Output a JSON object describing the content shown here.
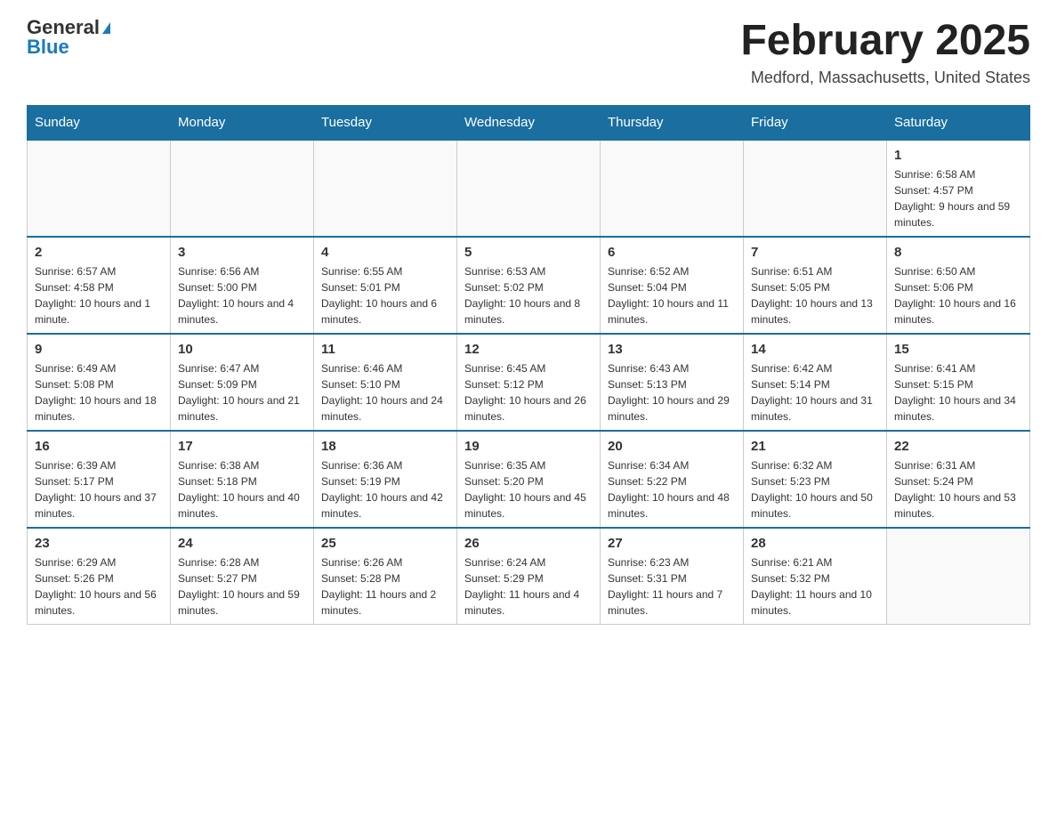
{
  "header": {
    "logo": {
      "general": "General",
      "blue": "Blue",
      "triangle": "▶"
    },
    "title": "February 2025",
    "location": "Medford, Massachusetts, United States"
  },
  "weekdays": [
    "Sunday",
    "Monday",
    "Tuesday",
    "Wednesday",
    "Thursday",
    "Friday",
    "Saturday"
  ],
  "weeks": [
    [
      {
        "day": "",
        "info": ""
      },
      {
        "day": "",
        "info": ""
      },
      {
        "day": "",
        "info": ""
      },
      {
        "day": "",
        "info": ""
      },
      {
        "day": "",
        "info": ""
      },
      {
        "day": "",
        "info": ""
      },
      {
        "day": "1",
        "info": "Sunrise: 6:58 AM\nSunset: 4:57 PM\nDaylight: 9 hours and 59 minutes."
      }
    ],
    [
      {
        "day": "2",
        "info": "Sunrise: 6:57 AM\nSunset: 4:58 PM\nDaylight: 10 hours and 1 minute."
      },
      {
        "day": "3",
        "info": "Sunrise: 6:56 AM\nSunset: 5:00 PM\nDaylight: 10 hours and 4 minutes."
      },
      {
        "day": "4",
        "info": "Sunrise: 6:55 AM\nSunset: 5:01 PM\nDaylight: 10 hours and 6 minutes."
      },
      {
        "day": "5",
        "info": "Sunrise: 6:53 AM\nSunset: 5:02 PM\nDaylight: 10 hours and 8 minutes."
      },
      {
        "day": "6",
        "info": "Sunrise: 6:52 AM\nSunset: 5:04 PM\nDaylight: 10 hours and 11 minutes."
      },
      {
        "day": "7",
        "info": "Sunrise: 6:51 AM\nSunset: 5:05 PM\nDaylight: 10 hours and 13 minutes."
      },
      {
        "day": "8",
        "info": "Sunrise: 6:50 AM\nSunset: 5:06 PM\nDaylight: 10 hours and 16 minutes."
      }
    ],
    [
      {
        "day": "9",
        "info": "Sunrise: 6:49 AM\nSunset: 5:08 PM\nDaylight: 10 hours and 18 minutes."
      },
      {
        "day": "10",
        "info": "Sunrise: 6:47 AM\nSunset: 5:09 PM\nDaylight: 10 hours and 21 minutes."
      },
      {
        "day": "11",
        "info": "Sunrise: 6:46 AM\nSunset: 5:10 PM\nDaylight: 10 hours and 24 minutes."
      },
      {
        "day": "12",
        "info": "Sunrise: 6:45 AM\nSunset: 5:12 PM\nDaylight: 10 hours and 26 minutes."
      },
      {
        "day": "13",
        "info": "Sunrise: 6:43 AM\nSunset: 5:13 PM\nDaylight: 10 hours and 29 minutes."
      },
      {
        "day": "14",
        "info": "Sunrise: 6:42 AM\nSunset: 5:14 PM\nDaylight: 10 hours and 31 minutes."
      },
      {
        "day": "15",
        "info": "Sunrise: 6:41 AM\nSunset: 5:15 PM\nDaylight: 10 hours and 34 minutes."
      }
    ],
    [
      {
        "day": "16",
        "info": "Sunrise: 6:39 AM\nSunset: 5:17 PM\nDaylight: 10 hours and 37 minutes."
      },
      {
        "day": "17",
        "info": "Sunrise: 6:38 AM\nSunset: 5:18 PM\nDaylight: 10 hours and 40 minutes."
      },
      {
        "day": "18",
        "info": "Sunrise: 6:36 AM\nSunset: 5:19 PM\nDaylight: 10 hours and 42 minutes."
      },
      {
        "day": "19",
        "info": "Sunrise: 6:35 AM\nSunset: 5:20 PM\nDaylight: 10 hours and 45 minutes."
      },
      {
        "day": "20",
        "info": "Sunrise: 6:34 AM\nSunset: 5:22 PM\nDaylight: 10 hours and 48 minutes."
      },
      {
        "day": "21",
        "info": "Sunrise: 6:32 AM\nSunset: 5:23 PM\nDaylight: 10 hours and 50 minutes."
      },
      {
        "day": "22",
        "info": "Sunrise: 6:31 AM\nSunset: 5:24 PM\nDaylight: 10 hours and 53 minutes."
      }
    ],
    [
      {
        "day": "23",
        "info": "Sunrise: 6:29 AM\nSunset: 5:26 PM\nDaylight: 10 hours and 56 minutes."
      },
      {
        "day": "24",
        "info": "Sunrise: 6:28 AM\nSunset: 5:27 PM\nDaylight: 10 hours and 59 minutes."
      },
      {
        "day": "25",
        "info": "Sunrise: 6:26 AM\nSunset: 5:28 PM\nDaylight: 11 hours and 2 minutes."
      },
      {
        "day": "26",
        "info": "Sunrise: 6:24 AM\nSunset: 5:29 PM\nDaylight: 11 hours and 4 minutes."
      },
      {
        "day": "27",
        "info": "Sunrise: 6:23 AM\nSunset: 5:31 PM\nDaylight: 11 hours and 7 minutes."
      },
      {
        "day": "28",
        "info": "Sunrise: 6:21 AM\nSunset: 5:32 PM\nDaylight: 11 hours and 10 minutes."
      },
      {
        "day": "",
        "info": ""
      }
    ]
  ]
}
